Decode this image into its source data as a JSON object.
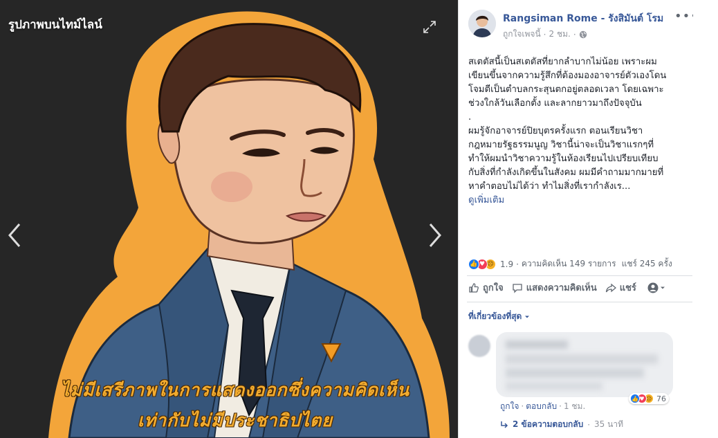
{
  "viewer": {
    "title": "รูปภาพบนไทม์ไลน์",
    "caption_line1": "ไม่มีเสรีภาพในการแสดงออกซึ่งความคิดเห็น",
    "caption_line2": "เท่ากับไม่มีประชาธิปไตย",
    "icons": {
      "expand": "expand-icon",
      "prev": "chevron-left-icon",
      "next": "chevron-right-icon"
    }
  },
  "post": {
    "author": "Rangsiman Rome - รังสิมันต์ โรม",
    "like_page": "ถูกใจเพจนี้",
    "time": "2 ชม.",
    "paragraphs": [
      "สเตตัสนี้เป็นสเตตัสที่ยากลำบากไม่น้อย เพราะผม",
      "เขียนขึ้นจากความรู้สึกที่ต้องมองอาจารย์ตัวเองโดน",
      "โจมตีเป็นตำบลกระสุนตกอยู่ตลอดเวลา โดยเฉพาะ",
      "ช่วงใกล้วันเลือกตั้ง และลากยาวมาถึงปัจจุบัน",
      ".",
      "ผมรู้จักอาจารย์ปิยบุตรครั้งแรก ตอนเรียนวิชา",
      "กฎหมายรัฐธรรมนูญ วิชานี้น่าจะเป็นวิชาแรกๆที่",
      "ทำให้ผมนำวิชาความรู้ในห้องเรียนไปเปรียบเทียบ",
      "กับสิ่งที่กำลังเกิดขึ้นในสังคม ผมมีคำถามมากมายที่",
      "หาคำตอบไม่ได้ว่า ทำไมสิ่งที่เรากำลังเร..."
    ],
    "see_more": "ดูเพิ่มเติม",
    "reactions_count": "1.9",
    "comments_count": "ความคิดเห็น 149 รายการ",
    "shares_count": "แชร์ 245 ครั้ง",
    "actions": {
      "like": "ถูกใจ",
      "comment": "แสดงความคิดเห็น",
      "share": "แชร์"
    },
    "relevant_filter": "ที่เกี่ยวข้องที่สุด"
  },
  "comment": {
    "like": "ถูกใจ",
    "reply": "ตอบกลับ",
    "time": "1 ชม.",
    "reaction_count": "76",
    "replies_link": "2 ข้อความตอบกลับ",
    "replies_time": "35 นาที"
  },
  "colors": {
    "link": "#385898",
    "like_blue": "#1877f2",
    "love_red": "#f33e58",
    "sad_yellow": "#f7b125",
    "caption_orange": "#f3ac2f",
    "viewer_bg": "#262626"
  }
}
